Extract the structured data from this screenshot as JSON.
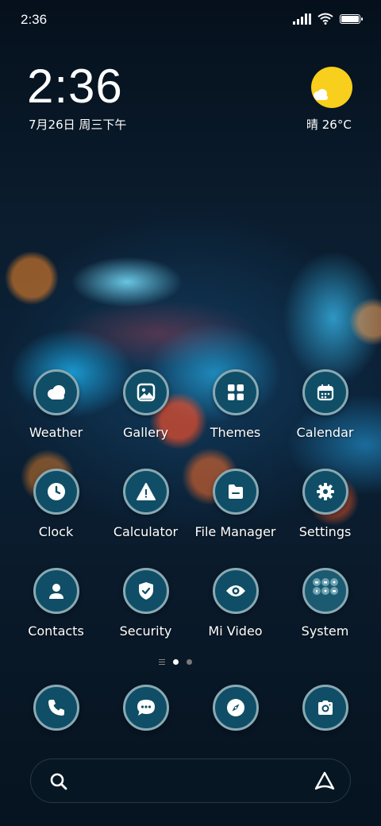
{
  "status_bar": {
    "time": "2:36"
  },
  "clock_widget": {
    "time": "2:36",
    "date": "7月26日 周三下午"
  },
  "weather_widget": {
    "text": "晴 26°C",
    "sun_color": "#f7cf1c"
  },
  "apps": [
    {
      "label": "Weather",
      "icon": "weather-icon"
    },
    {
      "label": "Gallery",
      "icon": "gallery-icon"
    },
    {
      "label": "Themes",
      "icon": "themes-icon"
    },
    {
      "label": "Calendar",
      "icon": "calendar-icon"
    },
    {
      "label": "Clock",
      "icon": "clock-icon"
    },
    {
      "label": "Calculator",
      "icon": "calculator-icon"
    },
    {
      "label": "File Manager",
      "icon": "file-manager-icon"
    },
    {
      "label": "Settings",
      "icon": "settings-icon"
    },
    {
      "label": "Contacts",
      "icon": "contacts-icon"
    },
    {
      "label": "Security",
      "icon": "security-icon"
    },
    {
      "label": "Mi Video",
      "icon": "mi-video-icon"
    },
    {
      "label": "System",
      "icon": "system-folder-icon"
    }
  ],
  "page_indicator": {
    "pages": 2,
    "current": 1
  },
  "dock": [
    {
      "icon": "phone-icon"
    },
    {
      "icon": "messages-icon"
    },
    {
      "icon": "browser-icon"
    },
    {
      "icon": "camera-icon"
    }
  ],
  "search_bar": {
    "left_icon": "search-icon",
    "right_icon": "assistant-icon"
  },
  "colors": {
    "icon_fill": "#0f4e66",
    "icon_ring": "#89a9b3"
  }
}
